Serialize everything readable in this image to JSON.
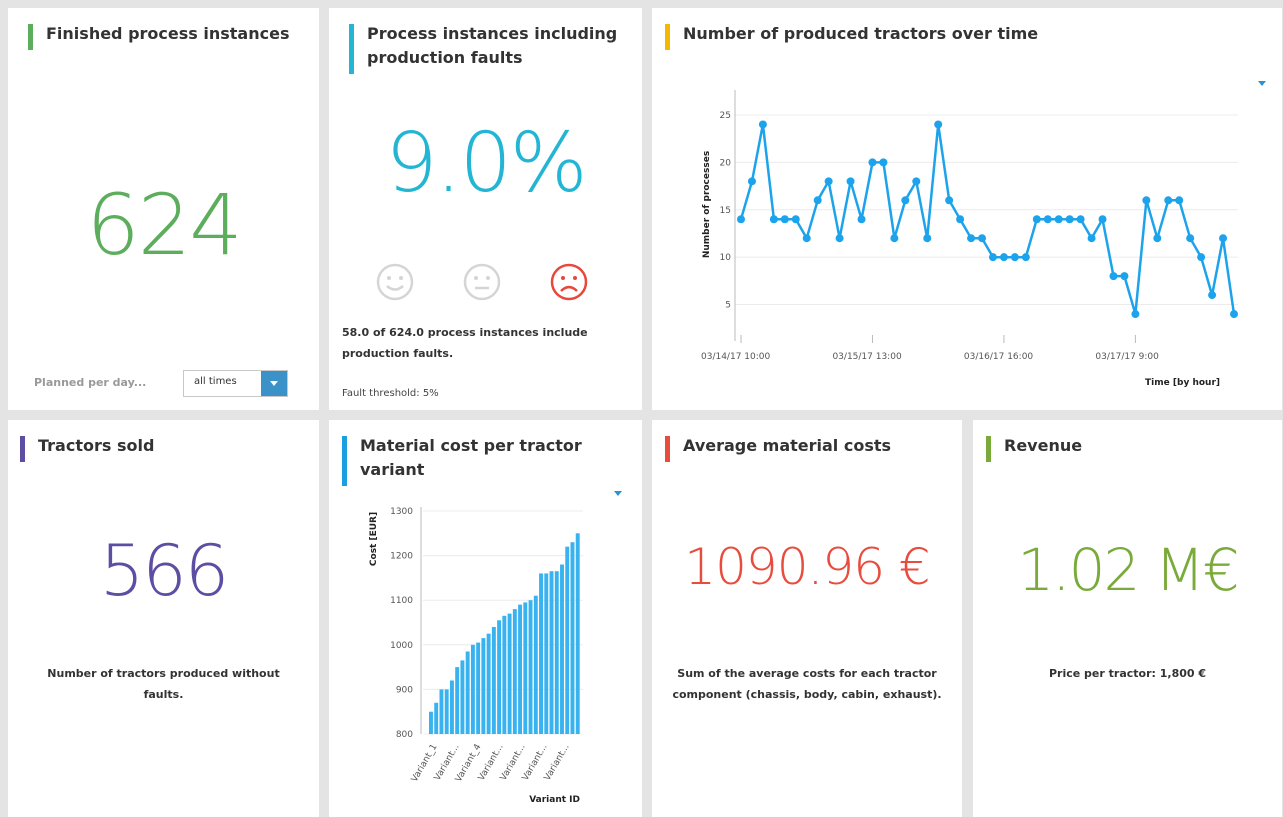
{
  "cards": {
    "finished": {
      "title": "Finished process instances",
      "value": "624",
      "planned_label": "Planned per day...",
      "select_value": "all times",
      "accent": "#5cad5c"
    },
    "faults": {
      "title_line1": "Process instances including",
      "title_line2": "production faults",
      "value": "9.0%",
      "desc_line1": "58.0 of 624.0 process instances include",
      "desc_line2": "production faults.",
      "threshold": "Fault threshold: 5%",
      "accent": "#23b5d3",
      "smileys": [
        "happy-face-icon",
        "neutral-face-icon",
        "sad-face-icon"
      ]
    },
    "tractors_over_time": {
      "title": "Number of produced tractors over time",
      "accent": "#f5b800"
    },
    "tractors_sold": {
      "title": "Tractors sold",
      "value": "566",
      "desc_line1": "Number of tractors produced without",
      "desc_line2": "faults.",
      "accent": "#5e4ea3"
    },
    "material_cost": {
      "title_line1": "Material cost per tractor",
      "title_line2": "variant",
      "accent": "#1a9fe0"
    },
    "avg_cost": {
      "title": "Average material costs",
      "value": "1090.96 €",
      "desc_line1": "Sum of the average costs for each tractor",
      "desc_line2": "component (chassis, body, cabin, exhaust).",
      "accent": "#e84c3d"
    },
    "revenue": {
      "title": "Revenue",
      "value": "1.02 M€",
      "desc": "Price per tractor: 1,800 €",
      "accent": "#7aab3a"
    }
  },
  "chart_data": [
    {
      "type": "line",
      "x_tick_labels": [
        "03/14/17 10:00",
        "03/15/17 13:00",
        "03/16/17 16:00",
        "03/17/17 9:00"
      ],
      "xlabel": "Time [by hour]",
      "ylabel": "Number of processes",
      "y_ticks": [
        5,
        10,
        15,
        20,
        25
      ],
      "ylim": [
        2,
        27
      ],
      "values": [
        14,
        18,
        24,
        14,
        14,
        14,
        12,
        16,
        18,
        12,
        18,
        14,
        20,
        20,
        12,
        16,
        18,
        12,
        24,
        16,
        14,
        12,
        12,
        10,
        10,
        10,
        10,
        14,
        14,
        14,
        14,
        14,
        12,
        14,
        8,
        8,
        4,
        16,
        12,
        16,
        16,
        12,
        10,
        6,
        12,
        4
      ],
      "color": "#1ca3ec",
      "grid": true
    },
    {
      "type": "bar",
      "ylabel": "Cost [EUR]",
      "xlabel": "Variant ID",
      "y_ticks": [
        800,
        900,
        1000,
        1100,
        1200,
        1300
      ],
      "ylim": [
        800,
        1300
      ],
      "x_tick_labels": [
        "Variant_1",
        "Variant...",
        "Variant_4",
        "Variant...",
        "Variant...",
        "Variant...",
        "Variant..."
      ],
      "values": [
        850,
        870,
        900,
        900,
        920,
        950,
        965,
        985,
        1000,
        1005,
        1015,
        1025,
        1040,
        1055,
        1065,
        1070,
        1080,
        1090,
        1095,
        1100,
        1110,
        1160,
        1160,
        1165,
        1165,
        1180,
        1220,
        1230,
        1250
      ],
      "color": "#38b3f0",
      "grid": true
    }
  ]
}
